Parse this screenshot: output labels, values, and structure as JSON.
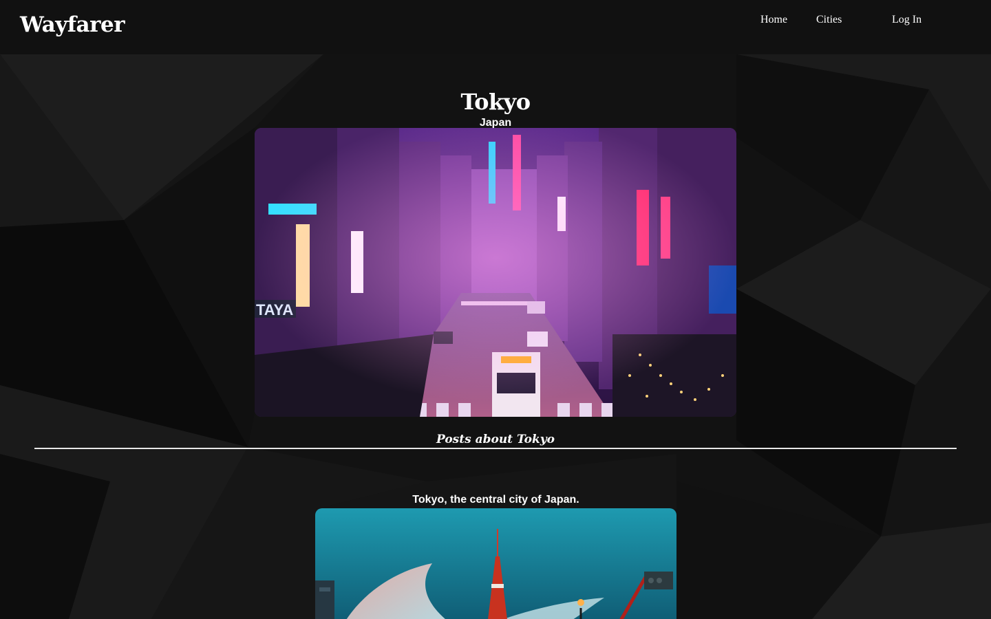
{
  "navbar": {
    "brand": "Wayfarer",
    "links": {
      "home": "Home",
      "cities": "Cities",
      "login": "Log In"
    }
  },
  "city": {
    "name": "Tokyo",
    "country": "Japan"
  },
  "posts": {
    "heading": "Posts about Tokyo",
    "items": [
      {
        "title": "Tokyo, the central city of Japan."
      }
    ]
  },
  "colors": {
    "navbar_bg": "#111111",
    "page_bg": "#0e0e0e",
    "text": "#ffffff",
    "divider": "#e8e8e8"
  }
}
